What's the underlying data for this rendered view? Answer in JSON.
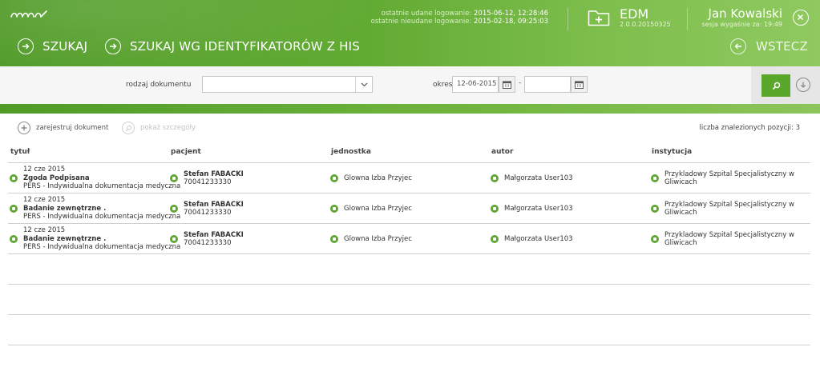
{
  "header": {
    "logo": "ammr",
    "last_login_label": "ostatnie udane logowanie:",
    "last_login_value": "2015-06-12, 12:28:46",
    "last_failed_label": "ostatnie nieudane logowanie:",
    "last_failed_value": "2015-02-18, 09:25:03",
    "app_title": "EDM",
    "app_version": "2.0.0.20150325",
    "user_name": "Jan Kowalski",
    "session_label": "sesja wygaśnie za:",
    "session_value": "19:49"
  },
  "nav": {
    "search": "SZUKAJ",
    "search_by_id": "SZUKAJ WG IDENTYFIKATORÓW Z HIS",
    "back": "WSTECZ"
  },
  "filters": {
    "doc_type_label": "rodzaj dokumentu",
    "doc_type_value": "",
    "period_label": "okres",
    "date_from": "12-06-2015",
    "date_to": "",
    "date_separator": "-"
  },
  "actions": {
    "register": "zarejestruj dokument",
    "details": "pokaż szczegóły",
    "count_label": "liczba znalezionych pozycji:",
    "count_value": "3"
  },
  "table": {
    "columns": [
      "tytuł",
      "pacjent",
      "jednostka",
      "autor",
      "instytucja"
    ],
    "rows": [
      {
        "date": "12 cze 2015",
        "title": "Zgoda Podpisana",
        "type": "PERS - Indywidualna dokumentacja medyczna",
        "patient_name": "Stefan FABACKI",
        "patient_id": "70041233330",
        "unit": "Glowna Izba Przyjec",
        "author": "Małgorzata User103",
        "institution_line1": "Przykladowy Szpital Specjalistyczny w",
        "institution_line2": "Gliwicach"
      },
      {
        "date": "12 cze 2015",
        "title": "Badanie zewnętrzne .",
        "type": "PERS - Indywidualna dokumentacja medyczna",
        "patient_name": "Stefan FABACKI",
        "patient_id": "70041233330",
        "unit": "Glowna Izba Przyjec",
        "author": "Małgorzata User103",
        "institution_line1": "Przykladowy Szpital Specjalistyczny w",
        "institution_line2": "Gliwicach"
      },
      {
        "date": "12 cze 2015",
        "title": "Badanie zewnętrzne .",
        "type": "PERS - Indywidualna dokumentacja medyczna",
        "patient_name": "Stefan FABACKI",
        "patient_id": "70041233330",
        "unit": "Glowna Izba Przyjec",
        "author": "Małgorzata User103",
        "institution_line1": "Przykladowy Szpital Specjalistyczny w",
        "institution_line2": "Gliwicach"
      }
    ]
  },
  "colors": {
    "brand_green": "#5aa72c",
    "header_dark": "#4f9a26",
    "header_light": "#8fc95f"
  }
}
